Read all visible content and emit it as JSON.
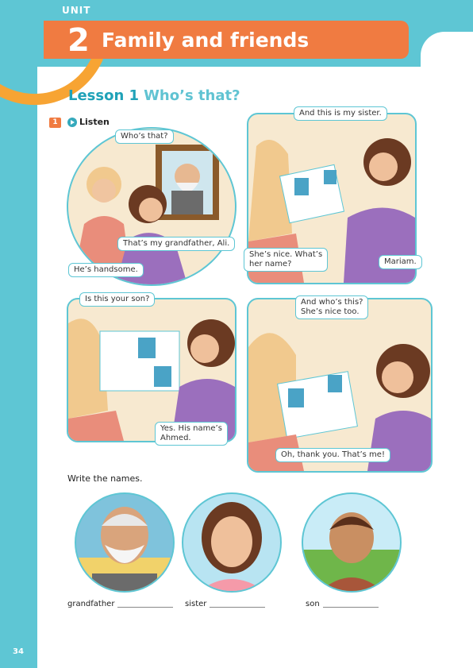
{
  "unit": {
    "label": "UNIT",
    "number": "2",
    "title": "Family and friends"
  },
  "lesson": {
    "number": "Lesson 1",
    "title": "Who’s that?"
  },
  "exercise": {
    "number": "1",
    "label": "Listen"
  },
  "bubbles": {
    "p1_a": "Who’s that?",
    "p1_b": "That’s my grandfather, Ali.",
    "p1_c": "He’s handsome.",
    "p2_a": "And this is my sister.",
    "p2_b": "She’s nice. What’s\nher name?",
    "p2_c": "Mariam.",
    "p3_a": "Is this your son?",
    "p3_b": "Yes. His name’s\nAhmed.",
    "p4_a": "And who’s this?\nShe’s nice too.",
    "p4_b": "Oh, thank you. That’s me!"
  },
  "write_instruction": "Write the names.",
  "names": [
    "grandfather",
    "sister",
    "son"
  ],
  "page_number": "34",
  "colors": {
    "teal": "#5ec6d4",
    "orange": "#f07b41",
    "lesson_blue": "#1fa2b8"
  }
}
